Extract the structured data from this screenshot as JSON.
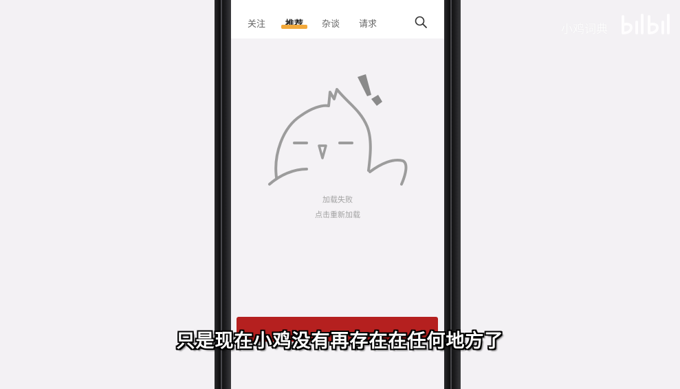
{
  "app": {
    "tabs": [
      {
        "label": "关注",
        "active": false
      },
      {
        "label": "推荐",
        "active": true
      },
      {
        "label": "杂谈",
        "active": false
      },
      {
        "label": "请求",
        "active": false
      }
    ],
    "search_icon": "search-icon",
    "accent_color": "#f2a93b"
  },
  "error_state": {
    "illustration": "sad-chick-mascot",
    "message": "加载失败",
    "retry_label": "点击重新加载"
  },
  "banner": {
    "color": "#b5201f"
  },
  "overlay": {
    "watermark": "小鸡词典",
    "logo": "bilibili-logo",
    "subtitle": "只是现在小鸡没有再存在在任何地方了"
  }
}
